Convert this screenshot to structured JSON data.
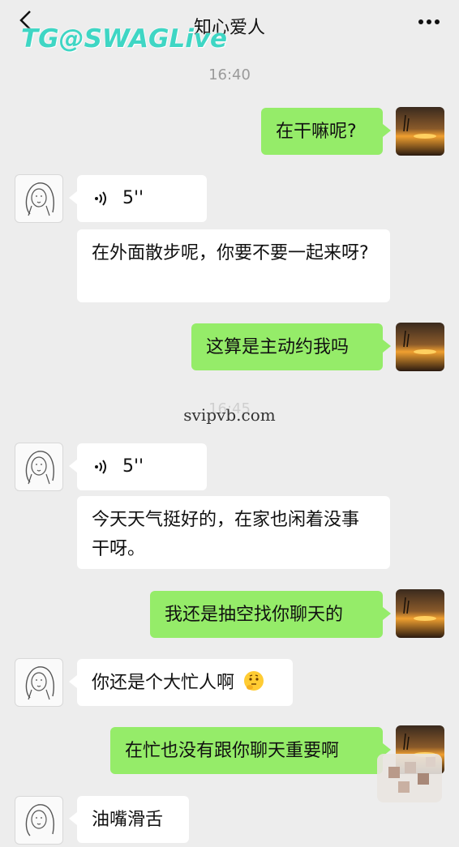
{
  "header": {
    "title": "知心爱人",
    "watermark": "TG@SWAGLive"
  },
  "site_mark": "svipvb.com",
  "messages": [
    {
      "type": "time",
      "text": "16:40"
    },
    {
      "type": "text",
      "side": "right",
      "text": "在干嘛呢?"
    },
    {
      "type": "voice",
      "side": "left",
      "duration": "5''"
    },
    {
      "type": "text",
      "side": "left",
      "text": "在外面散步呢，你要不要一起来呀?"
    },
    {
      "type": "text",
      "side": "right",
      "text": "这算是主动约我吗"
    },
    {
      "type": "time",
      "text": "16:45"
    },
    {
      "type": "voice",
      "side": "left",
      "duration": "5''"
    },
    {
      "type": "text",
      "side": "left",
      "text": "今天天气挺好的，在家也闲着没事干呀。"
    },
    {
      "type": "text",
      "side": "right",
      "text": "我还是抽空找你聊天的"
    },
    {
      "type": "text",
      "side": "left",
      "text": "你还是个大忙人啊",
      "emoji": "thinking-face"
    },
    {
      "type": "text",
      "side": "right",
      "text": "在忙也没有跟你聊天重要啊"
    },
    {
      "type": "text",
      "side": "left",
      "text": "油嘴滑舌"
    }
  ],
  "colors": {
    "background": "#ededed",
    "green_bubble": "#95ec69",
    "white_bubble": "#ffffff",
    "watermark": "#3fd6c4"
  },
  "icons": {
    "back": "chevron-left-icon",
    "more": "more-dots-icon",
    "voice": "voice-wave-icon"
  }
}
